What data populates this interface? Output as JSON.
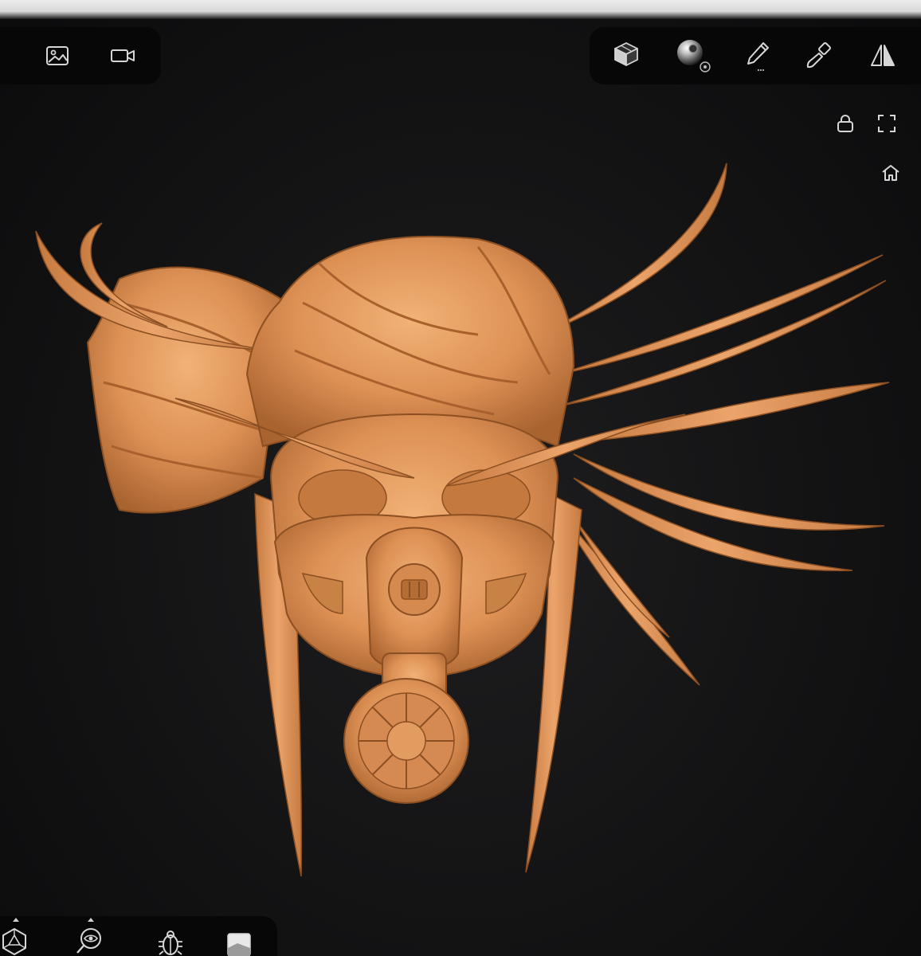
{
  "app": {
    "canvas_background": "#131314",
    "model_material_color": "#e0955a"
  },
  "toolbars": {
    "top_left": [
      {
        "name": "gallery-icon"
      },
      {
        "name": "video-camera-icon"
      }
    ],
    "top_right": [
      {
        "name": "scene-box-icon"
      },
      {
        "name": "material-sphere-icon"
      },
      {
        "name": "brush-pen-icon"
      },
      {
        "name": "paint-brush-icon"
      },
      {
        "name": "symmetry-icon"
      }
    ],
    "right_side": [
      {
        "name": "lock-icon"
      },
      {
        "name": "fullscreen-icon"
      },
      {
        "name": "home-icon"
      }
    ],
    "bottom": [
      {
        "name": "polyhedron-icon"
      },
      {
        "name": "inspect-eye-icon"
      },
      {
        "name": "bug-icon"
      },
      {
        "name": "cube-icon"
      }
    ]
  }
}
